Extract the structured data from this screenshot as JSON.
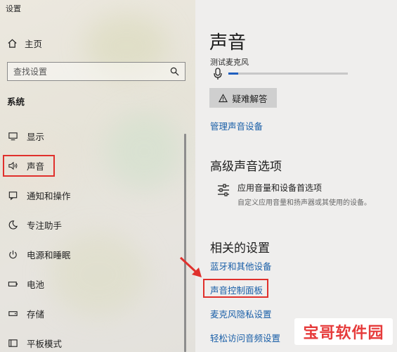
{
  "window": {
    "title": "设置"
  },
  "sidebar": {
    "home_label": "主页",
    "search_placeholder": "查找设置",
    "group_label": "系统",
    "items": [
      {
        "label": "显示",
        "icon": "monitor-icon"
      },
      {
        "label": "声音",
        "icon": "speaker-icon",
        "selected": true
      },
      {
        "label": "通知和操作",
        "icon": "notification-icon"
      },
      {
        "label": "专注助手",
        "icon": "moon-icon"
      },
      {
        "label": "电源和睡眠",
        "icon": "power-icon"
      },
      {
        "label": "电池",
        "icon": "battery-icon"
      },
      {
        "label": "存储",
        "icon": "storage-icon"
      },
      {
        "label": "平板模式",
        "icon": "tablet-icon"
      }
    ]
  },
  "main": {
    "title": "声音",
    "mic_test_label": "测试麦克风",
    "mic_level": 0.08,
    "troubleshoot_label": "疑难解答",
    "manage_devices_link": "管理声音设备",
    "advanced": {
      "heading": "高级声音选项",
      "item_title": "应用音量和设备首选项",
      "item_desc": "自定义应用音量和扬声器或其使用的设备。"
    },
    "related": {
      "heading": "相关的设置",
      "links": [
        "蓝牙和其他设备",
        "声音控制面板",
        "麦克风隐私设置",
        "轻松访问音频设置"
      ]
    }
  },
  "watermark": "宝哥软件园",
  "colors": {
    "accent": "#1a5fa8",
    "highlight": "#e0302c"
  }
}
